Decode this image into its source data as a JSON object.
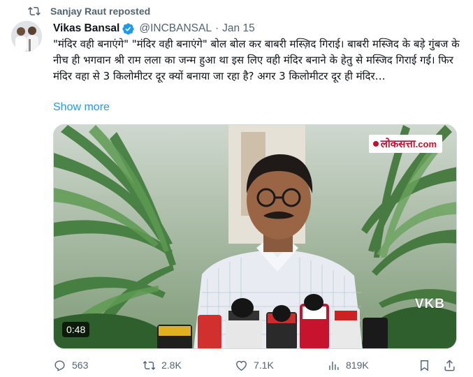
{
  "repost": {
    "text": "Sanjay Raut reposted",
    "icon": "repost-icon"
  },
  "author": {
    "name": "Vikas Bansal",
    "handle": "@INCBANSAL",
    "separator": "·",
    "date": "Jan 15",
    "verified_color": "#1d9bf0"
  },
  "tweet": {
    "text": "\"मंदिर वही बनाएंगे\" \"मंदिर वही बनाएंगे\" बोल बोल कर बाबरी मस्ज़िद गिराई। बाबरी मस्जिद के बड़े गुंबज के नीच ही भगवान श्री राम लला का जन्म हुआ था इस लिए वही मंदिर बनाने के हेतु से मस्जिद गिराई गई। फिर मंदिर वहा से 3 किलोमीटर दूर क्यों बनाया जा रहा है? अगर 3 किलोमीटर दूर ही मंदिर…",
    "show_more": "Show more"
  },
  "media": {
    "logo_part1": "लोकसत्ता",
    "logo_part2": ".com",
    "watermark": "VKB",
    "duration": "0:48"
  },
  "actions": {
    "replies": "563",
    "reposts": "2.8K",
    "likes": "7.1K",
    "views": "819K"
  },
  "colors": {
    "accent": "#1d9bf0",
    "muted_text": "#536471",
    "primary_text": "#0f1419",
    "brand_red": "#c8102e"
  }
}
